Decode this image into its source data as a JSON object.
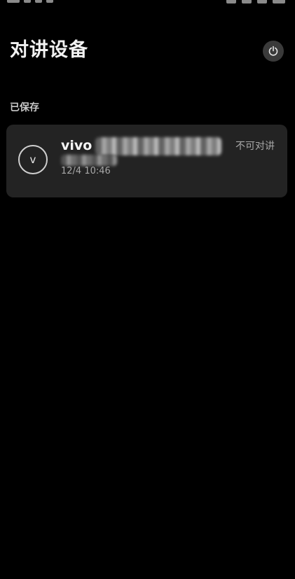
{
  "header": {
    "title": "对讲设备",
    "power_icon": "power-icon"
  },
  "saved_section": {
    "label": "已保存",
    "devices": [
      {
        "avatar_letter": "v",
        "name": "vivo",
        "time": "12/4 10:46",
        "status": "不可对讲"
      }
    ]
  },
  "colors": {
    "background": "#000000",
    "card": "#232323",
    "power_button": "#3a3a3a"
  }
}
